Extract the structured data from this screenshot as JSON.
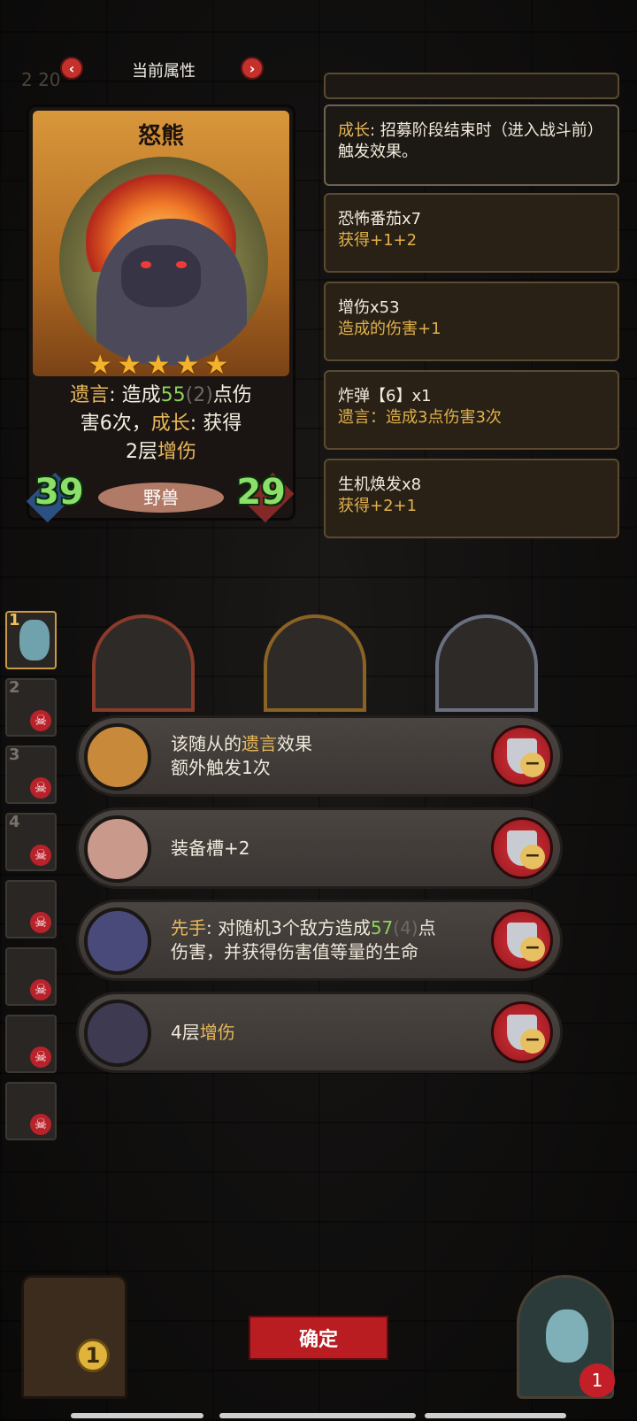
{
  "header": {
    "title": "当前属性",
    "prev": "‹",
    "next": "›",
    "coins_ghost": "2 20"
  },
  "card": {
    "name": "怒熊",
    "star_count": 5,
    "desc_line1_kw": "遗言",
    "desc_line1_a": ": 造成",
    "desc_line1_num": "55",
    "desc_line1_dim": "(2)",
    "desc_line1_b": "点伤",
    "desc_line2_a": "害6次，",
    "desc_line2_kw": "成长",
    "desc_line2_b": ": 获得",
    "desc_line3_a": "2层",
    "desc_line3_kw": "增伤",
    "attack": "39",
    "health": "29",
    "tribe": "野兽"
  },
  "growth_panel": {
    "kw": "成长",
    "text": ": 招募阶段结束时（进入战斗前）触发效果。"
  },
  "items": [
    {
      "name": "恐怖番茄x7",
      "effect": "获得+1+2"
    },
    {
      "name": "增伤x53",
      "effect": "造成的伤害+1"
    },
    {
      "name": "炸弹【6】x1",
      "effect": "遗言：造成3点伤害3次"
    },
    {
      "name": "生机焕发x8",
      "effect": "获得+2+1"
    }
  ],
  "roster": [
    {
      "num": "1",
      "active": true
    },
    {
      "num": "2",
      "active": false
    },
    {
      "num": "3",
      "active": false
    },
    {
      "num": "4",
      "active": false
    },
    {
      "num": "",
      "active": false
    },
    {
      "num": "",
      "active": false
    },
    {
      "num": "",
      "active": false
    },
    {
      "num": "",
      "active": false
    }
  ],
  "equip": [
    {
      "prefix": "该随从的",
      "kw": "遗言",
      "suffix": "效果",
      "line2": "额外触发1次",
      "icon_color": "#c88a3a"
    },
    {
      "prefix": "装备槽+2",
      "kw": "",
      "suffix": "",
      "line2": "",
      "icon_color": "#c99a8c"
    },
    {
      "kw_first": "先手",
      "text_a": ": 对随机3个敌方造成",
      "num": "57",
      "dim": "(4)",
      "text_b": "点",
      "line2": "伤害，并获得伤害值等量的生命",
      "icon_color": "#4a4a7a"
    },
    {
      "prefix": "4层",
      "kw": "增伤",
      "suffix": "",
      "line2": "",
      "icon_color": "#3e3a52"
    }
  ],
  "confirm": "确定",
  "gold": "1",
  "lives": "1",
  "colors": {
    "accent_gold": "#e8b85a",
    "accent_green": "#8bd35a",
    "button_red": "#b91d22"
  }
}
